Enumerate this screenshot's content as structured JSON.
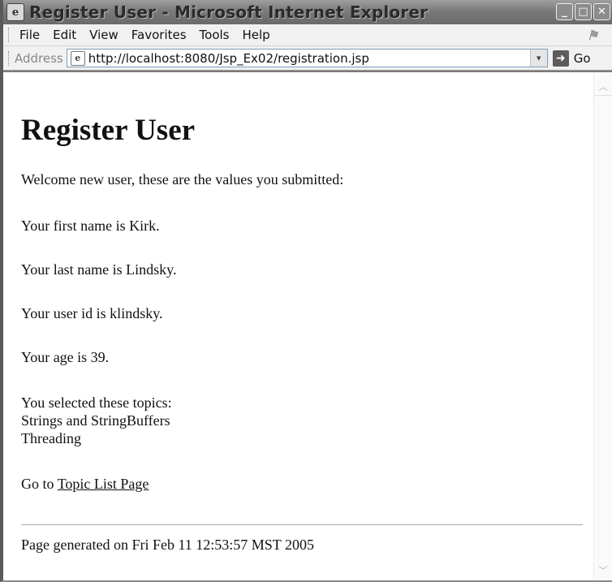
{
  "window": {
    "title": "Register User - Microsoft Internet Explorer",
    "buttons": {
      "minimize": "_",
      "maximize": "□",
      "close": "✕"
    }
  },
  "menubar": {
    "items": [
      "File",
      "Edit",
      "View",
      "Favorites",
      "Tools",
      "Help"
    ]
  },
  "addressbar": {
    "label": "Address",
    "url": "http://localhost:8080/Jsp_Ex02/registration.jsp",
    "go_label": "Go"
  },
  "page": {
    "heading": "Register User",
    "welcome": "Welcome new user, these are the values you submitted:",
    "first_name_line": "Your first name is Kirk.",
    "last_name_line": "Your last name is Lindsky.",
    "user_id_line": "Your user id is klindsky.",
    "age_line": "Your age is 39.",
    "topics_intro": "You selected these topics:",
    "topics": [
      "Strings and StringBuffers",
      "Threading"
    ],
    "goto_prefix": "Go to ",
    "goto_link": "Topic List Page",
    "footer": "Page generated on Fri Feb 11 12:53:57 MST 2005"
  },
  "icons": {
    "title": "ie-page-icon",
    "logo": "windows-logo-icon",
    "address_page": "ie-page-icon",
    "go": "go-arrow-icon",
    "dropdown": "chevron-down-icon"
  }
}
